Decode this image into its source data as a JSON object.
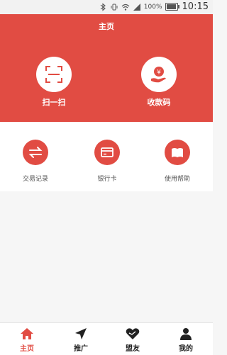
{
  "status_bar": {
    "battery": "100%",
    "time": "10:15"
  },
  "header": {
    "title": "主页"
  },
  "actions": [
    {
      "label": "扫一扫",
      "icon": "scan-icon"
    },
    {
      "label": "收款码",
      "icon": "receive-money-icon",
      "glyph": "¥"
    }
  ],
  "grid": [
    {
      "label": "交易记录",
      "icon": "transfer-arrows-icon"
    },
    {
      "label": "银行卡",
      "icon": "bank-card-icon"
    },
    {
      "label": "使用帮助",
      "icon": "book-icon"
    }
  ],
  "tabs": [
    {
      "label": "主页",
      "icon": "home-icon",
      "active": true
    },
    {
      "label": "推广",
      "icon": "send-arrow-icon"
    },
    {
      "label": "盟友",
      "icon": "heart-icon"
    },
    {
      "label": "我的",
      "icon": "user-icon"
    }
  ],
  "colors": {
    "accent": "#e14c43",
    "header_bg": "#e14c43",
    "page_bg": "#f6f6f6"
  }
}
